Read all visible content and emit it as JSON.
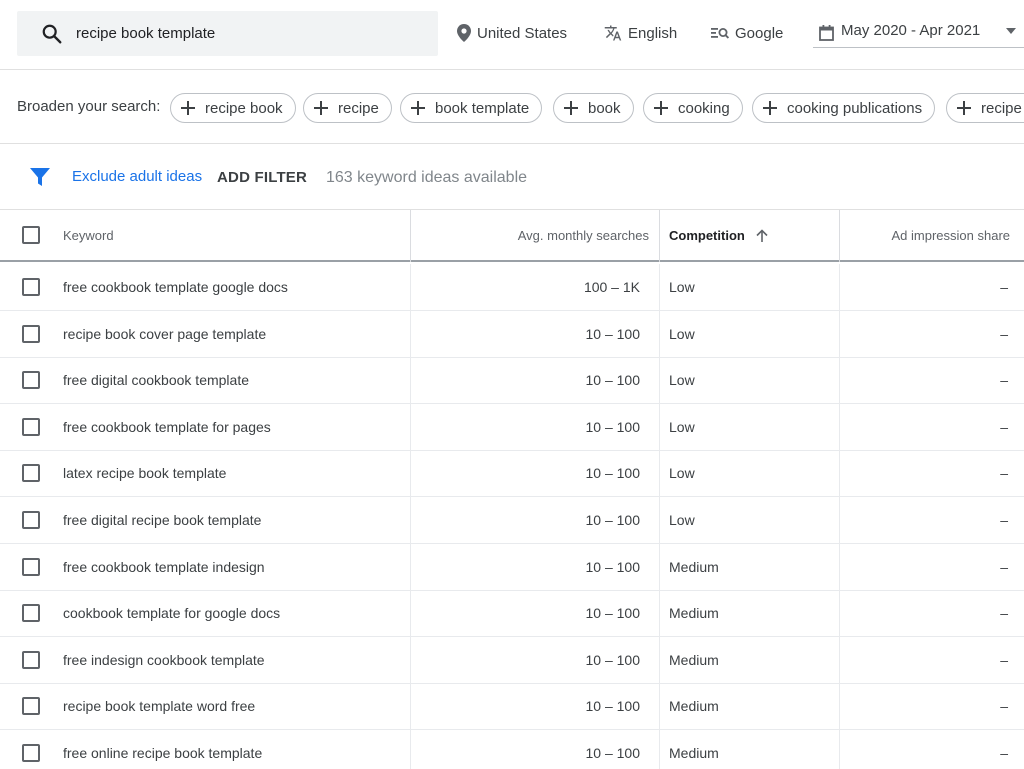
{
  "search": {
    "query": "recipe book template"
  },
  "top_bar": {
    "location": "United States",
    "language": "English",
    "network": "Google",
    "date_range": "May 2020 - Apr 2021"
  },
  "broaden": {
    "label": "Broaden your search:",
    "chips": [
      "recipe book",
      "recipe",
      "book template",
      "book",
      "cooking",
      "cooking publications",
      "recipe c"
    ]
  },
  "filters": {
    "exclude_adult": "Exclude adult ideas",
    "add_filter": "ADD FILTER",
    "ideas_count": "163 keyword ideas available"
  },
  "table": {
    "headers": {
      "keyword": "Keyword",
      "searches": "Avg. monthly searches",
      "competition": "Competition",
      "impression_share": "Ad impression share"
    },
    "rows": [
      {
        "keyword": "free cookbook template google docs",
        "searches": "100 – 1K",
        "competition": "Low",
        "share": "–"
      },
      {
        "keyword": "recipe book cover page template",
        "searches": "10 – 100",
        "competition": "Low",
        "share": "–"
      },
      {
        "keyword": "free digital cookbook template",
        "searches": "10 – 100",
        "competition": "Low",
        "share": "–"
      },
      {
        "keyword": "free cookbook template for pages",
        "searches": "10 – 100",
        "competition": "Low",
        "share": "–"
      },
      {
        "keyword": "latex recipe book template",
        "searches": "10 – 100",
        "competition": "Low",
        "share": "–"
      },
      {
        "keyword": "free digital recipe book template",
        "searches": "10 – 100",
        "competition": "Low",
        "share": "–"
      },
      {
        "keyword": "free cookbook template indesign",
        "searches": "10 – 100",
        "competition": "Medium",
        "share": "–"
      },
      {
        "keyword": "cookbook template for google docs",
        "searches": "10 – 100",
        "competition": "Medium",
        "share": "–"
      },
      {
        "keyword": "free indesign cookbook template",
        "searches": "10 – 100",
        "competition": "Medium",
        "share": "–"
      },
      {
        "keyword": "recipe book template word free",
        "searches": "10 – 100",
        "competition": "Medium",
        "share": "–"
      },
      {
        "keyword": "free online recipe book template",
        "searches": "10 – 100",
        "competition": "Medium",
        "share": "–"
      }
    ]
  }
}
